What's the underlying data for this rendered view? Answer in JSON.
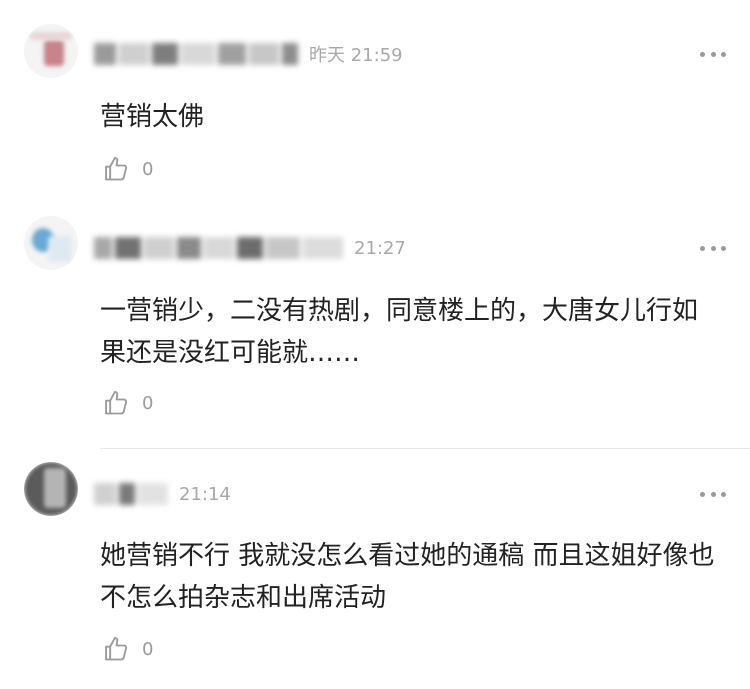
{
  "comments": [
    {
      "time": "昨天 21:59",
      "text": "营销太佛",
      "likes": "0",
      "avatar_colors": [
        "#c9838a",
        "#e9d4d6"
      ],
      "name_colors": [
        "#9a9a9a",
        "#cfcfcf",
        "#7e7e7e",
        "#d8d8d8",
        "#a0a0a0",
        "#c7c7c7",
        "#8d8d8d"
      ]
    },
    {
      "time": "21:27",
      "text": "一营销少，二没有热剧，同意楼上的，大唐女儿行如果还是没红可能就……",
      "likes": "0",
      "avatar_colors": [
        "#6aa9d6",
        "#dfe9f2"
      ],
      "name_colors": [
        "#a7a7a7",
        "#717171",
        "#cfcfcf",
        "#8a8a8a",
        "#d8d8d8",
        "#6c6c6c",
        "#c6c6c6",
        "#dcdcdc"
      ]
    },
    {
      "time": "21:14",
      "text": "她营销不行 我就没怎么看过她的通稿 而且这姐好像也不怎么拍杂志和出席活动",
      "likes": "0",
      "avatar_colors": [
        "#5b5b5b",
        "#b4b4b4"
      ],
      "name_colors": [
        "#d0d0d0",
        "#7a7a7a",
        "#e2e2e2"
      ]
    }
  ],
  "icons": {
    "like": "thumbs-up-outline-icon",
    "more": "more-horizontal-icon"
  },
  "colors": {
    "text": "#222222",
    "meta": "#a8a8a8",
    "icon": "#9a9a9a",
    "divider": "#e8e8e8"
  }
}
